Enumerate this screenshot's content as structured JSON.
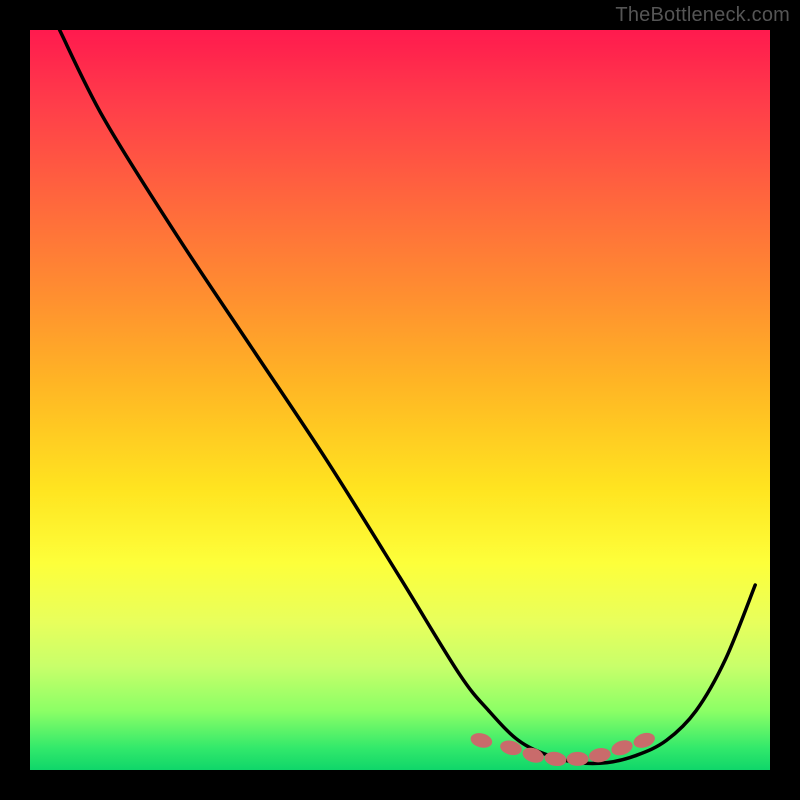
{
  "watermark": "TheBottleneck.com",
  "colors": {
    "page_bg": "#000000",
    "gradient_top": "#ff1a4e",
    "gradient_bottom": "#0fd66a",
    "curve": "#000000",
    "markers": "#c96b6b"
  },
  "chart_data": {
    "type": "line",
    "title": "",
    "xlabel": "",
    "ylabel": "",
    "xlim": [
      0,
      100
    ],
    "ylim": [
      0,
      100
    ],
    "grid": false,
    "legend": false,
    "series": [
      {
        "name": "bottleneck-curve",
        "x": [
          4,
          10,
          20,
          30,
          40,
          50,
          58,
          62,
          66,
          70,
          74,
          78,
          82,
          86,
          90,
          94,
          98
        ],
        "y": [
          100,
          88,
          72,
          57,
          42,
          26,
          13,
          8,
          4,
          2,
          1,
          1,
          2,
          4,
          8,
          15,
          25
        ]
      }
    ],
    "markers": {
      "name": "highlight-points",
      "x": [
        61,
        65,
        68,
        71,
        74,
        77,
        80,
        83
      ],
      "y": [
        4,
        3,
        2,
        1.5,
        1.5,
        2,
        3,
        4
      ]
    }
  }
}
